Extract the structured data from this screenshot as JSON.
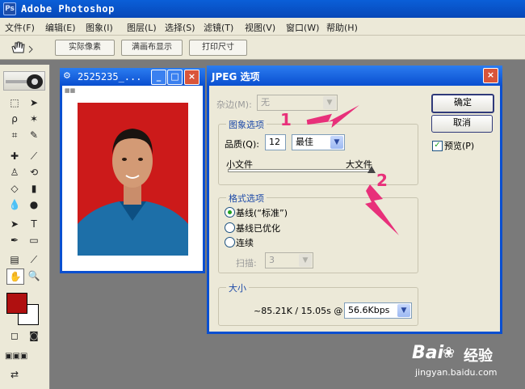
{
  "app": {
    "title": "Adobe Photoshop",
    "icon": "photoshop-icon"
  },
  "menu": [
    "文件(F)",
    "编辑(E)",
    "图象(I)",
    "图层(L)",
    "选择(S)",
    "滤镜(T)",
    "视图(V)",
    "窗口(W)",
    "帮助(H)"
  ],
  "options_bar": {
    "buttons": [
      "实际像素",
      "满画布显示",
      "打印尺寸"
    ],
    "tool_icon": "hand-icon"
  },
  "document": {
    "title": "2525235_...",
    "min": "_",
    "max": "□",
    "close": "×"
  },
  "dialog": {
    "title": "JPEG 选项",
    "close": "×",
    "matte_label": "杂边(M):",
    "matte_value": "无",
    "image_options": {
      "legend": "图象选项",
      "quality_label": "品质(Q):",
      "quality_value": "12",
      "quality_preset": "最佳",
      "small_file": "小文件",
      "large_file": "大文件",
      "quality_fraction": 1.0
    },
    "format_options": {
      "legend": "格式选项",
      "options": [
        "基线(“标准”)",
        "基线已优化",
        "连续"
      ],
      "selected": 0,
      "scans_label": "扫描:",
      "scans_value": "3"
    },
    "size": {
      "legend": "大小",
      "text": "~85.21K / 15.05s @",
      "speed": "56.6Kbps"
    },
    "ok": "确定",
    "cancel": "取消",
    "preview_label": "预览(P)",
    "preview_checked": true
  },
  "annotations": [
    "1",
    "2"
  ],
  "watermark": {
    "brand": "Bai",
    "brand2": "经验",
    "url": "jingyan.baidu.com"
  },
  "colors": {
    "xp_blue": "#0a4fd0",
    "dialog_bg": "#ece9d8",
    "photo_bg": "#cc1a1a",
    "annotation": "#e8307a",
    "foreground": "#b01010"
  }
}
